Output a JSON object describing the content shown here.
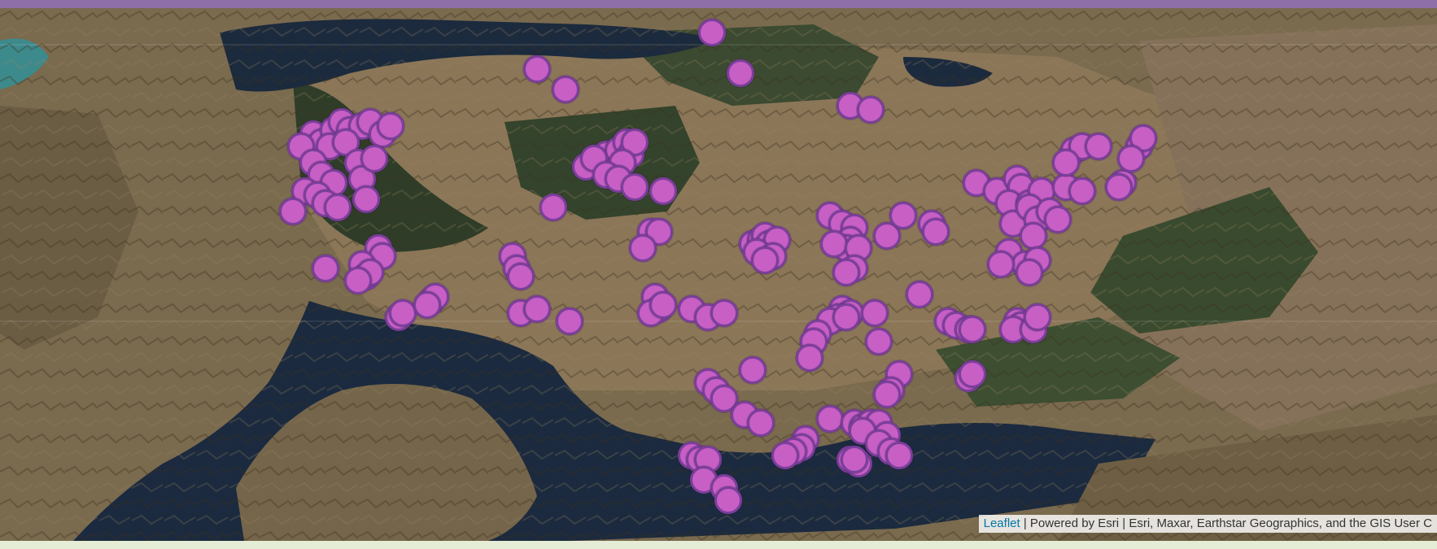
{
  "colors": {
    "header_bar": "#8f6fa8",
    "marker_fill": "#c75fc5",
    "marker_stroke": "#7a3f9a",
    "water": "#1c2a3d",
    "land": "#7a6a4e"
  },
  "map": {
    "basemap": "satellite imagery",
    "marker_count": 150
  },
  "attribution": {
    "link_text": "Leaflet",
    "separator": " | ",
    "text": "Powered by Esri | Esri, Maxar, Earthstar Geographics, and the GIS User C"
  }
}
